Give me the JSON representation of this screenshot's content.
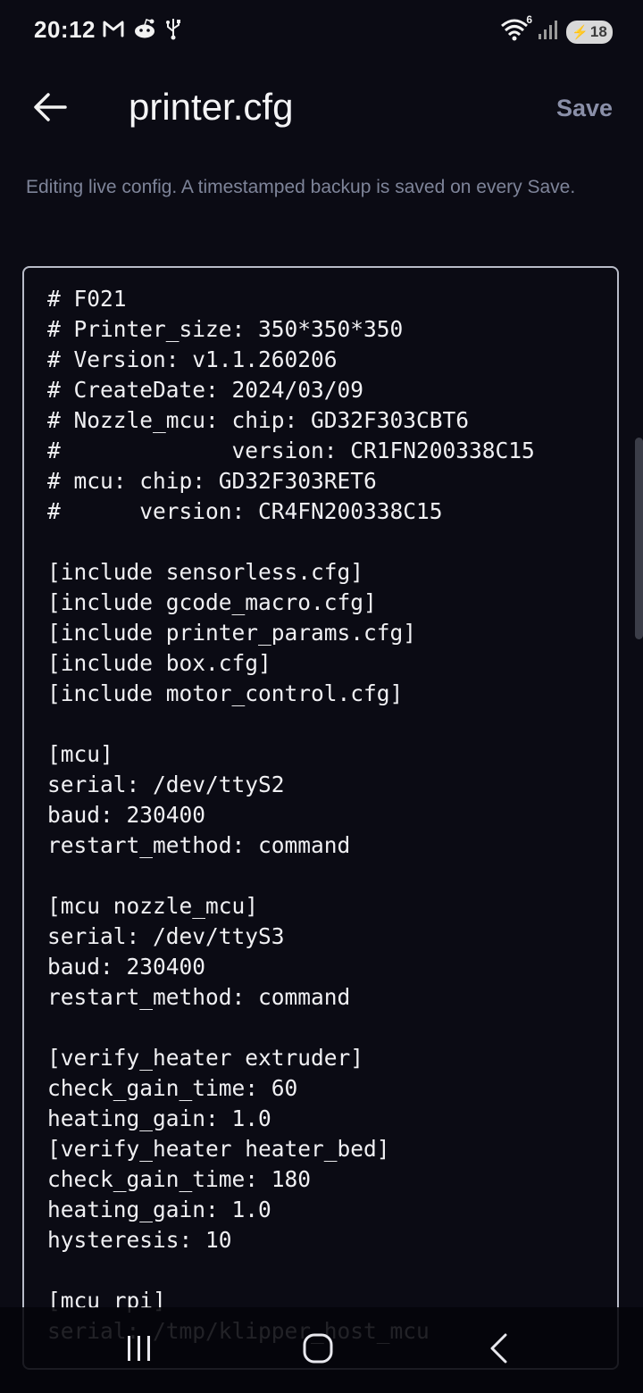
{
  "status_bar": {
    "time": "20:12",
    "left_icons": [
      "gmail-icon",
      "reddit-icon",
      "usb-icon"
    ],
    "wifi_badge": "6",
    "battery_level": "18"
  },
  "app_bar": {
    "title": "printer.cfg",
    "save_label": "Save"
  },
  "info_text": "Editing live config. A timestamped backup is saved on every Save.",
  "editor": {
    "content": "# F021\n# Printer_size: 350*350*350\n# Version: v1.1.260206\n# CreateDate: 2024/03/09\n# Nozzle_mcu: chip: GD32F303CBT6\n#             version: CR1FN200338C15\n# mcu: chip: GD32F303RET6\n#      version: CR4FN200338C15\n\n[include sensorless.cfg]\n[include gcode_macro.cfg]\n[include printer_params.cfg]\n[include box.cfg]\n[include motor_control.cfg]\n\n[mcu]\nserial: /dev/ttyS2\nbaud: 230400\nrestart_method: command\n\n[mcu nozzle_mcu]\nserial: /dev/ttyS3\nbaud: 230400\nrestart_method: command\n\n[verify_heater extruder]\ncheck_gain_time: 60\nheating_gain: 1.0\n[verify_heater heater_bed]\ncheck_gain_time: 180\nheating_gain: 1.0\nhysteresis: 10\n\n[mcu rpi]\nserial: /tmp/klipper_host_mcu"
  },
  "nav_bar": {
    "buttons": [
      "recent-apps-icon",
      "home-icon",
      "back-icon"
    ]
  },
  "colors": {
    "background": "#0b0b14",
    "muted_text": "#7e8499",
    "save_text": "#8a8fa8",
    "editor_border": "#b9bcc8"
  }
}
